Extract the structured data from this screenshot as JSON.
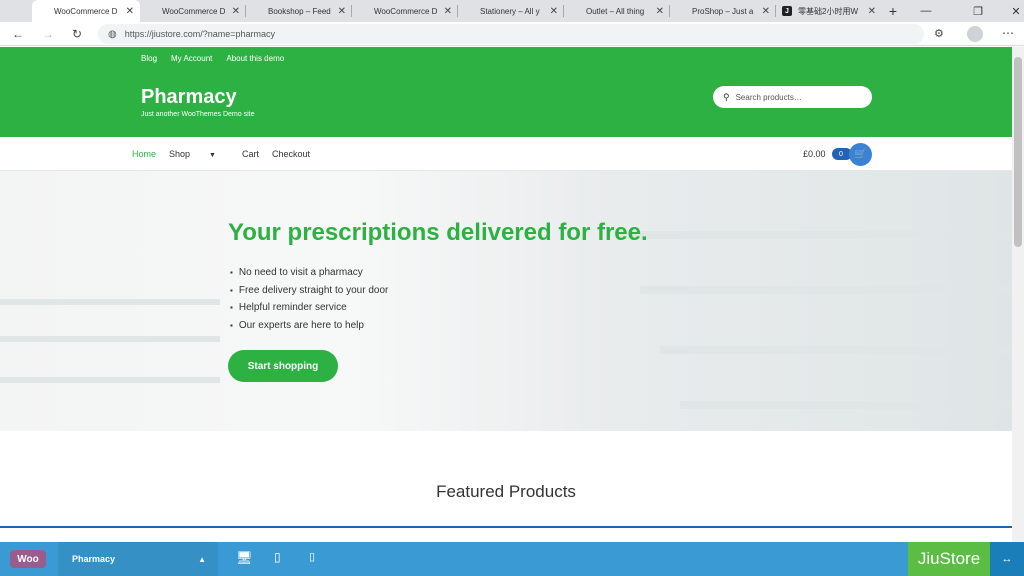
{
  "browser": {
    "tabs": [
      {
        "label": "WooCommerce D",
        "active": true
      },
      {
        "label": "WooCommerce D"
      },
      {
        "label": "Bookshop – Feed"
      },
      {
        "label": "WooCommerce D"
      },
      {
        "label": "Stationery – All y"
      },
      {
        "label": "Outlet – All thing"
      },
      {
        "label": "ProShop – Just a"
      },
      {
        "label": "零基础2小时用W"
      }
    ],
    "new_tab": "+",
    "url": "https://jiustore.com/?name=pharmacy"
  },
  "site": {
    "top_links": [
      "Blog",
      "My Account",
      "About this demo"
    ],
    "title": "Pharmacy",
    "tagline": "Just another WooThemes Demo site",
    "search_placeholder": "Search products…",
    "nav": [
      "Home",
      "Shop",
      "Cart",
      "Checkout"
    ],
    "cart_total": "£0.00",
    "cart_count": "0",
    "hero": {
      "heading": "Your prescriptions delivered for free.",
      "bullets": [
        "No need to visit a pharmacy",
        "Free delivery straight to your door",
        "Helpful reminder service",
        "Our experts are here to help"
      ],
      "button": "Start shopping"
    },
    "featured_heading": "Featured Products"
  },
  "demo_bar": {
    "woo_logo": "Woo",
    "store": "Pharmacy",
    "brand": "JiuStore"
  },
  "icons": {
    "globe": "globe-icon",
    "cart": "basket-icon"
  }
}
